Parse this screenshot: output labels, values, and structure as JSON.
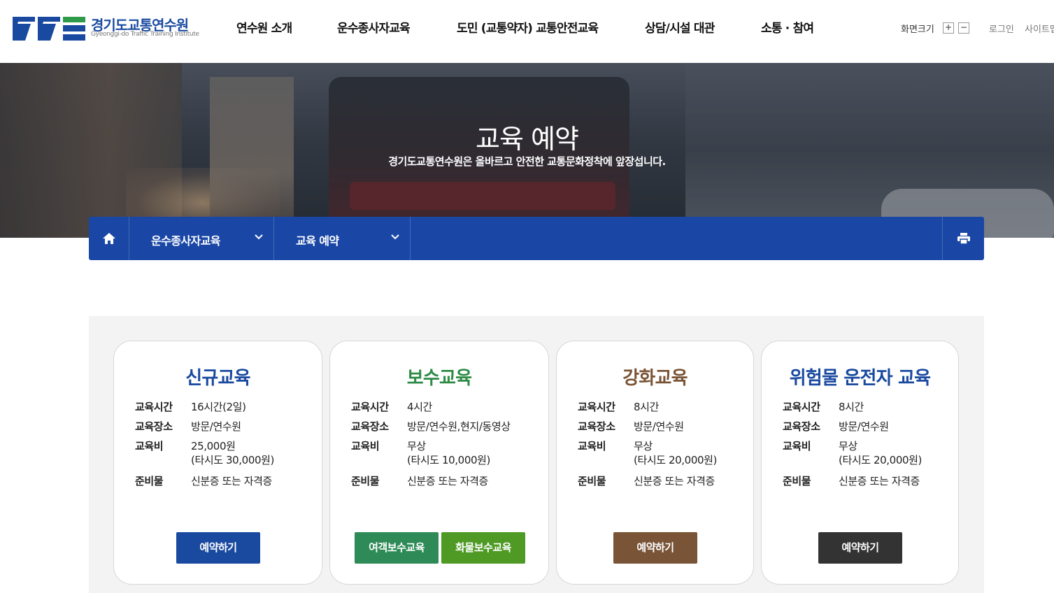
{
  "header": {
    "logo_title": "경기도교통연수원",
    "logo_subtitle": "Gyeonggi-do Traffic Training Institute",
    "nav": [
      "연수원 소개",
      "운수종사자교육",
      "도민 (교통약자) 교통안전교육",
      "상담/시설 대관",
      "소통 · 참여"
    ],
    "font_size_label": "화면크기",
    "font_plus": "+",
    "font_minus": "−",
    "login": "로그인",
    "sitemap": "사이트맵"
  },
  "hero": {
    "title": "교육 예약",
    "subtitle": "경기도교통연수원은 올바르고 안전한 교통문화정착에 앞장섭니다."
  },
  "location": {
    "depth1": "운수종사자교육",
    "depth2": "교육 예약"
  },
  "labels": {
    "time": "교육시간",
    "place": "교육장소",
    "fee": "교육비",
    "prep": "준비물"
  },
  "cards": [
    {
      "title": "신규교육",
      "color": "#1a4aa0",
      "time": "16시간(2일)",
      "place": "방문/연수원",
      "fee": "25,000원",
      "fee_note": "(타시도 30,000원)",
      "prep": "신분증 또는 자격증",
      "buttons": [
        {
          "label": "예약하기",
          "color": "#1a4aa0"
        }
      ]
    },
    {
      "title": "보수교육",
      "color": "#2e8b45",
      "time": "4시간",
      "place": "방문/연수원,현지/동영상",
      "fee": "무상",
      "fee_note": "(타시도 10,000원)",
      "prep": "신분증 또는 자격증",
      "buttons": [
        {
          "label": "여객보수교육",
          "color": "#2e8b57"
        },
        {
          "label": "화물보수교육",
          "color": "#4e9a25"
        }
      ]
    },
    {
      "title": "강화교육",
      "color": "#7a5436",
      "time": "8시간",
      "place": "방문/연수원",
      "fee": "무상",
      "fee_note": "(타시도 20,000원)",
      "prep": "신분증 또는 자격증",
      "buttons": [
        {
          "label": "예약하기",
          "color": "#7a5436"
        }
      ]
    },
    {
      "title": "위험물 운전자 교육",
      "color": "#1a4aa0",
      "time": "8시간",
      "place": "방문/연수원",
      "fee": "무상",
      "fee_note": "(타시도 20,000원)",
      "prep": "신분증 또는 자격증",
      "buttons": [
        {
          "label": "예약하기",
          "color": "#333333"
        }
      ]
    }
  ]
}
